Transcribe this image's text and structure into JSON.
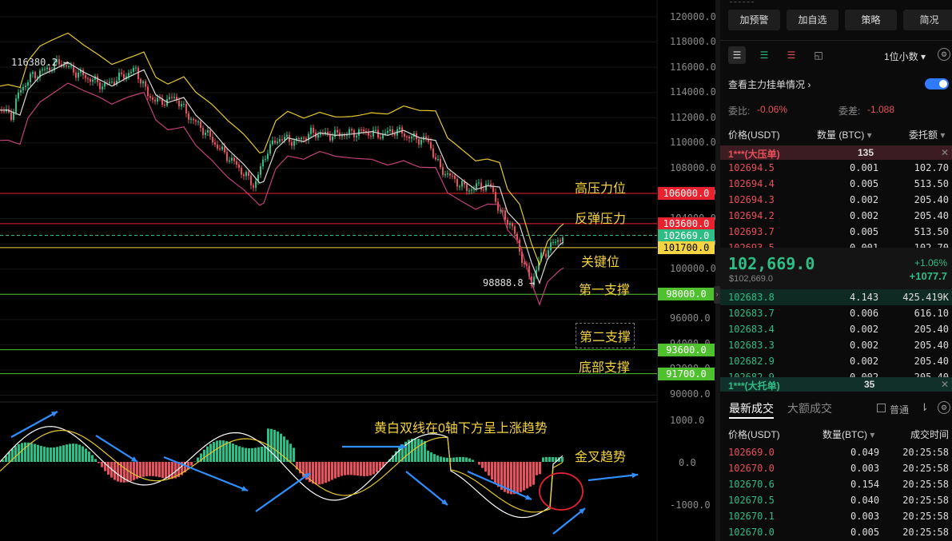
{
  "price_axis": [
    "120000.0",
    "118000.0",
    "116000.0",
    "114000.0",
    "112000.0",
    "110000.0",
    "108000.0",
    "106000.0",
    "104000.0",
    "102000.0",
    "100000.0",
    "98000.0",
    "96000.0",
    "94000.0",
    "92000.0",
    "90000.0"
  ],
  "macd_axis": [
    "1000.0",
    "0.0",
    "-1000.0"
  ],
  "levels": [
    {
      "price": "106000.0",
      "color": "#e8232f",
      "label": "高压力位"
    },
    {
      "price": "103600.0",
      "color": "#e8232f",
      "label": "反弹压力"
    },
    {
      "price": "102669.0",
      "color": "#2ebd85",
      "label": ""
    },
    {
      "price": "101700.0",
      "color": "#f5d442",
      "label": "关键位"
    },
    {
      "price": "98000.0",
      "color": "#4fc12f",
      "label": "第一支撑"
    },
    {
      "price": "93600.0",
      "color": "#4fc12f",
      "label": "第二支撑"
    },
    {
      "price": "91700.0",
      "color": "#4fc12f",
      "label": "底部支撑"
    }
  ],
  "high_marker": "116380.2 →",
  "low_marker": "98888.8 →",
  "macd_annotations": {
    "trend": "黄白双线在0轴下方呈上涨趋势",
    "cross": "金叉趋势"
  },
  "panel": {
    "buttons": [
      "加预警",
      "加自选",
      "策略",
      "简况"
    ],
    "decimal": "1位小数",
    "toggle_label": "查看主力挂单情况",
    "weibi_label": "委比:",
    "weibi_value": "-0.06%",
    "weicha_label": "委差:",
    "weicha_value": "-1.088",
    "col_price": "价格(USDT)",
    "col_qty": "数量 (BTC)",
    "col_amount": "委托额",
    "big_ask_label": "1***(大压单)",
    "big_ask_qty": "135",
    "asks": [
      {
        "p": "102694.5",
        "q": "0.001",
        "a": "102.70"
      },
      {
        "p": "102694.4",
        "q": "0.005",
        "a": "513.50"
      },
      {
        "p": "102694.3",
        "q": "0.002",
        "a": "205.40"
      },
      {
        "p": "102694.2",
        "q": "0.002",
        "a": "205.40"
      },
      {
        "p": "102693.7",
        "q": "0.005",
        "a": "513.50"
      },
      {
        "p": "102693.5",
        "q": "0.001",
        "a": "102.70"
      }
    ],
    "last_price": "102,669.0",
    "last_usd": "$102,669.0",
    "change_pct": "+1.06%",
    "change_abs": "+1077.7",
    "bids": [
      {
        "p": "102683.8",
        "q": "4.143",
        "a": "425.419K"
      },
      {
        "p": "102683.7",
        "q": "0.006",
        "a": "616.10"
      },
      {
        "p": "102683.4",
        "q": "0.002",
        "a": "205.40"
      },
      {
        "p": "102683.3",
        "q": "0.002",
        "a": "205.40"
      },
      {
        "p": "102682.9",
        "q": "0.002",
        "a": "205.40"
      },
      {
        "p": "102682.9",
        "q": "0.002",
        "a": "205.40"
      }
    ],
    "big_bid_label": "1***(大托单)",
    "big_bid_qty": "35",
    "tab_latest": "最新成交",
    "tab_large": "大额成交",
    "checkbox_label": "普通",
    "trades_col_price": "价格(USDT)",
    "trades_col_qty": "数量(BTC)",
    "trades_col_time": "成交时间",
    "trades": [
      {
        "p": "102669.0",
        "q": "0.049",
        "t": "20:25:58",
        "side": "sell"
      },
      {
        "p": "102670.0",
        "q": "0.003",
        "t": "20:25:58",
        "side": "sell"
      },
      {
        "p": "102670.6",
        "q": "0.154",
        "t": "20:25:58",
        "side": "buy"
      },
      {
        "p": "102670.5",
        "q": "0.040",
        "t": "20:25:58",
        "side": "buy"
      },
      {
        "p": "102670.1",
        "q": "0.003",
        "t": "20:25:58",
        "side": "buy"
      },
      {
        "p": "102670.0",
        "q": "0.005",
        "t": "20:25:58",
        "side": "buy"
      }
    ]
  },
  "colors": {
    "up": "#2ebd85",
    "down": "#e8505b",
    "yellow": "#f5d442",
    "panel_bg": "#0b0b0b"
  }
}
